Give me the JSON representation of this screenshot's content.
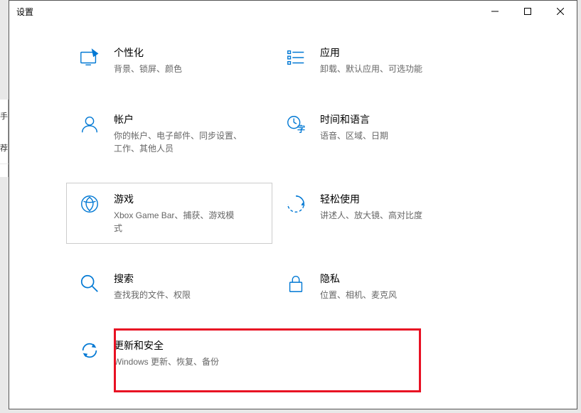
{
  "window": {
    "title": "设置"
  },
  "categories": [
    {
      "key": "personalization",
      "label": "个性化",
      "desc": "背景、锁屏、颜色"
    },
    {
      "key": "apps",
      "label": "应用",
      "desc": "卸载、默认应用、可选功能"
    },
    {
      "key": "accounts",
      "label": "帐户",
      "desc": "你的帐户、电子邮件、同步设置、工作、其他人员"
    },
    {
      "key": "time-language",
      "label": "时间和语言",
      "desc": "语音、区域、日期"
    },
    {
      "key": "gaming",
      "label": "游戏",
      "desc": "Xbox Game Bar、捕获、游戏模式",
      "selected": true
    },
    {
      "key": "ease-of-access",
      "label": "轻松使用",
      "desc": "讲述人、放大镜、高对比度"
    },
    {
      "key": "search",
      "label": "搜索",
      "desc": "查找我的文件、权限"
    },
    {
      "key": "privacy",
      "label": "隐私",
      "desc": "位置、相机、麦克风"
    },
    {
      "key": "update-security",
      "label": "更新和安全",
      "desc": "Windows 更新、恢复、备份",
      "highlighted": true
    }
  ],
  "side": {
    "a": "手",
    "b": "荐"
  }
}
